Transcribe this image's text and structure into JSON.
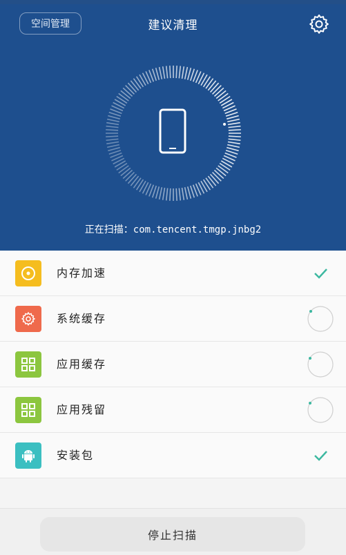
{
  "header": {
    "space_button_label": "空间管理",
    "title": "建议清理",
    "settings_icon": "gear-icon"
  },
  "scanner": {
    "center_icon": "phone-icon",
    "scanning_text": "正在扫描：com.tencent.tmgp.jnbg2"
  },
  "items": [
    {
      "label": "内存加速",
      "icon": "memory-boost-icon",
      "icon_color": "#f5bd1f",
      "status": "done"
    },
    {
      "label": "系统缓存",
      "icon": "system-gear-icon",
      "icon_color": "#ef6a4c",
      "status": "scanning"
    },
    {
      "label": "应用缓存",
      "icon": "app-grid-icon",
      "icon_color": "#8cc63f",
      "status": "scanning"
    },
    {
      "label": "应用残留",
      "icon": "app-grid-icon",
      "icon_color": "#8cc63f",
      "status": "scanning"
    },
    {
      "label": "安装包",
      "icon": "android-icon",
      "icon_color": "#3bbfc1",
      "status": "done"
    }
  ],
  "footer": {
    "stop_button_label": "停止扫描"
  },
  "colors": {
    "header_bg": "#1e4f8e",
    "check": "#3cb8a0"
  }
}
